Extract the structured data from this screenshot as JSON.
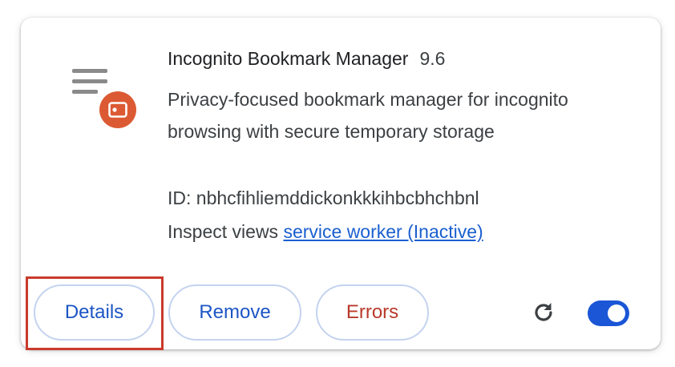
{
  "extension": {
    "name": "Incognito Bookmark Manager",
    "version": "9.6",
    "description": "Privacy-focused bookmark manager for incognito browsing with secure temporary storage",
    "id_label": "ID: nbhcfihliemddickonkkkihbcbhchbnl",
    "inspect_label": "Inspect views",
    "inspect_link": "service worker (Inactive)",
    "enabled": true
  },
  "buttons": {
    "details": "Details",
    "remove": "Remove",
    "errors": "Errors"
  },
  "icons": {
    "extension_icon": "list-menu-with-storage-badge-icon",
    "reload": "reload-icon",
    "toggle": "toggle-switch-on"
  },
  "colors": {
    "primary_blue": "#1c55c5",
    "error_red": "#b83a2b",
    "badge_orange": "#dc5a33",
    "toggle_on": "#1a56d6",
    "highlight": "#c93a2b"
  }
}
